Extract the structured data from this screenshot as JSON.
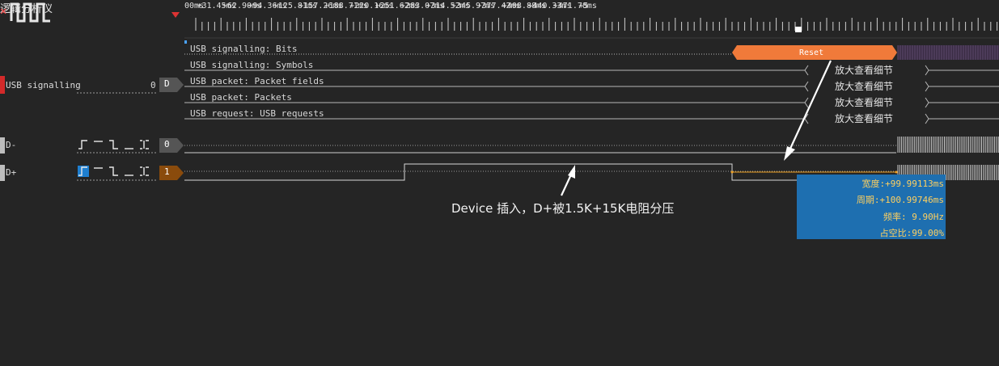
{
  "app": {
    "title": "逻辑分析仪"
  },
  "ruler": {
    "ticks": [
      "00ms",
      "+31.45ms",
      "+62.90ms",
      "+94.36ms",
      "+125.81ms",
      "+157.26ms",
      "+188.71ms",
      "+220.16ms",
      "+251.62ms",
      "+283.07ms",
      "+314.52ms",
      "+345.97ms",
      "+377.42ms",
      "+408.88ms",
      "+440.33ms",
      "+471.78ms",
      "+5"
    ]
  },
  "annotations": {
    "rows": [
      "USB signalling: Bits",
      "USB signalling: Symbols",
      "USB packet: Packet fields",
      "USB packet: Packets",
      "USB request: USB requests"
    ],
    "reset_label": "Reset",
    "zoom_hint": "放大查看细节"
  },
  "channels": [
    {
      "name": "USB signalling",
      "value": "0",
      "tag": "D",
      "marker_color": "#d32a2a",
      "tag_color": "#555555"
    },
    {
      "name": "D-",
      "tag": "0",
      "marker_color": "#bdbdbd",
      "tag_color": "#555555"
    },
    {
      "name": "D+",
      "tag": "1",
      "marker_color": "#bdbdbd",
      "tag_color": "#8a4b0c"
    }
  ],
  "trigger_icons": [
    "rising-edge-icon",
    "high-level-icon",
    "falling-edge-icon",
    "low-level-icon",
    "any-edge-icon"
  ],
  "caption": "Device 插入，D+被1.5K+15K电阻分压",
  "measurement": {
    "width": "宽度:+99.99113ms",
    "period": "周期:+100.99746ms",
    "frequency": "频率: 9.90Hz",
    "duty": "占空比:99.00%"
  },
  "colors": {
    "reset": "#f07a3a",
    "measure_line": "#f0a020",
    "measure_box": "#1e6fb0",
    "accent_red": "#d33333"
  }
}
